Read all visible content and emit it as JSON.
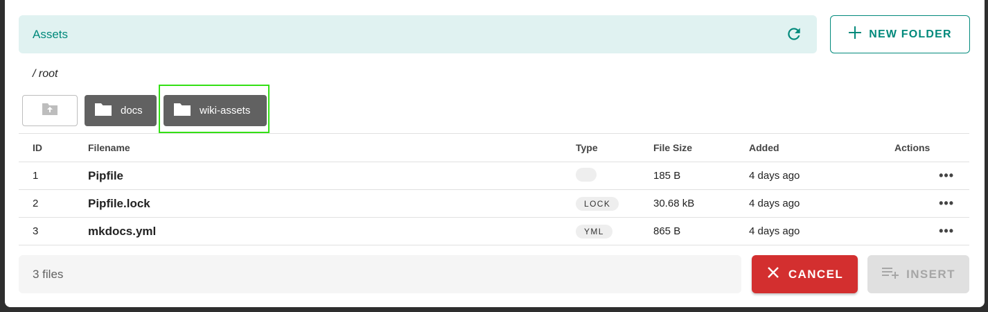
{
  "header": {
    "title": "Assets",
    "refresh_icon": "refresh-icon",
    "new_folder_label": "NEW FOLDER",
    "accent_color": "#00897b"
  },
  "breadcrumb": "/ root",
  "folders": [
    {
      "label": "docs"
    },
    {
      "label": "wiki-assets",
      "highlighted": true
    }
  ],
  "table": {
    "columns": [
      "ID",
      "Filename",
      "Type",
      "File Size",
      "Added",
      "Actions"
    ],
    "rows": [
      {
        "id": "1",
        "filename": "Pipfile",
        "type": "",
        "size": "185 B",
        "added": "4 days ago",
        "actions": "•••"
      },
      {
        "id": "2",
        "filename": "Pipfile.lock",
        "type": "LOCK",
        "size": "30.68 kB",
        "added": "4 days ago",
        "actions": "•••"
      },
      {
        "id": "3",
        "filename": "mkdocs.yml",
        "type": "YML",
        "size": "865 B",
        "added": "4 days ago",
        "actions": "•••"
      }
    ]
  },
  "footer": {
    "file_count": "3 files",
    "cancel_label": "CANCEL",
    "insert_label": "INSERT",
    "cancel_color": "#d32f2f"
  }
}
